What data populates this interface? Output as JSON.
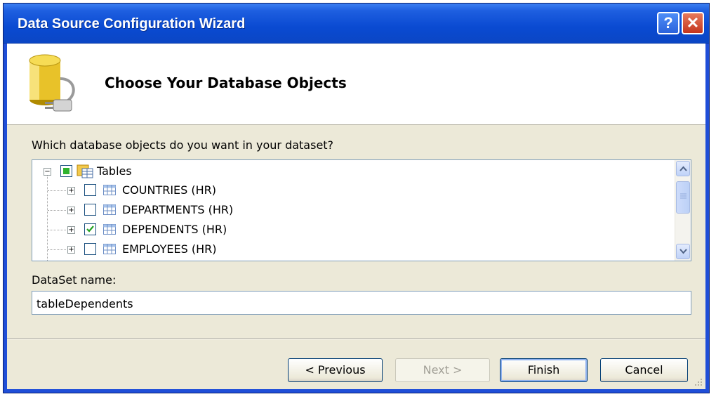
{
  "window": {
    "title": "Data Source Configuration Wizard",
    "help_glyph": "?",
    "close_glyph": "✕"
  },
  "banner": {
    "heading": "Choose Your Database Objects",
    "icon": "database-plug-icon"
  },
  "objects": {
    "prompt": "Which database objects do you want in your dataset?",
    "root": {
      "label": "Tables",
      "expanded": true,
      "checked": "partial"
    },
    "items": [
      {
        "label": "COUNTRIES (HR)",
        "checked": false
      },
      {
        "label": "DEPARTMENTS (HR)",
        "checked": false
      },
      {
        "label": "DEPENDENTS (HR)",
        "checked": true
      },
      {
        "label": "EMPLOYEES (HR)",
        "checked": false
      }
    ]
  },
  "dataset": {
    "label": "DataSet name:",
    "value": "tableDependents"
  },
  "buttons": {
    "previous": "< Previous",
    "next": "Next >",
    "finish": "Finish",
    "cancel": "Cancel"
  },
  "colors": {
    "title_bar": "#0a4ad2",
    "check": "#21a121"
  }
}
